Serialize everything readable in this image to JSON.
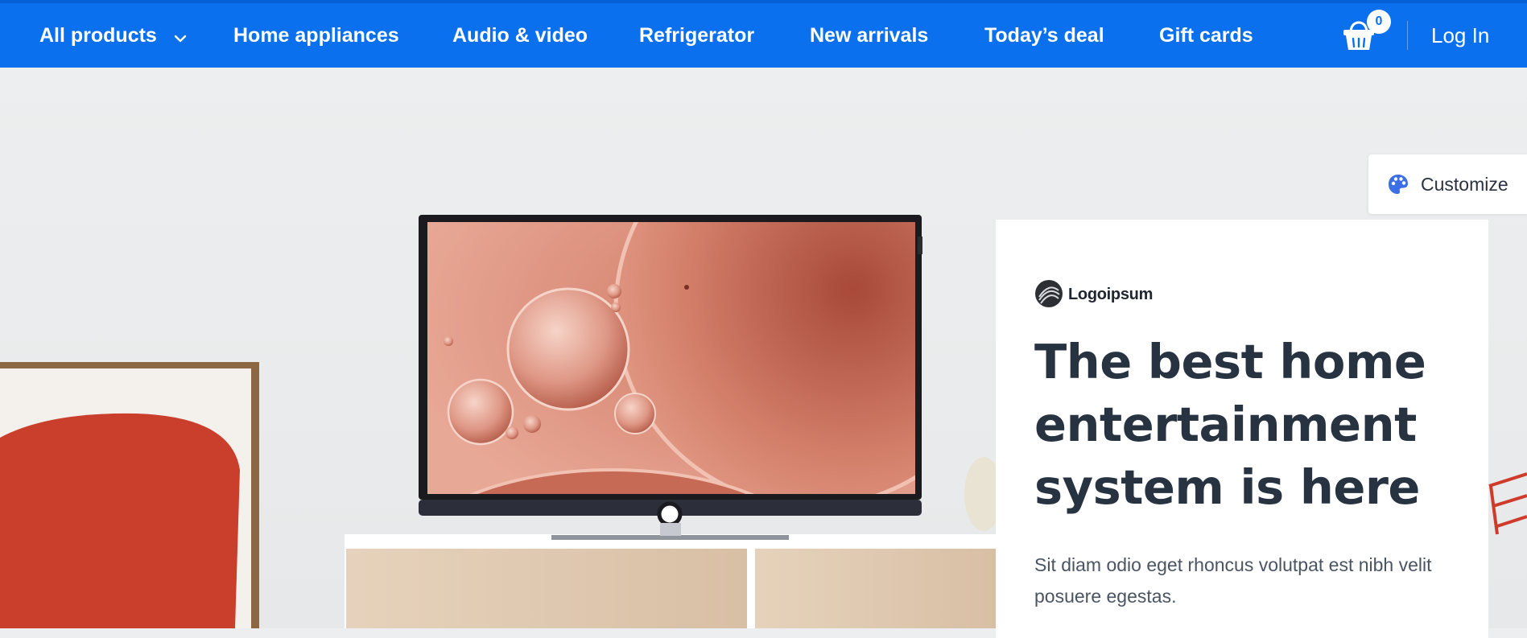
{
  "nav": {
    "all_products": "All products",
    "items": [
      "Home appliances",
      "Audio & video",
      "Refrigerator",
      "New arrivals",
      "Today’s deal",
      "Gift cards"
    ],
    "cart_count": "0",
    "login": "Log In",
    "background_color": "#0a70ee"
  },
  "customize": {
    "label": "Customize",
    "icon": "palette-icon"
  },
  "hero_card": {
    "brand": "Logoipsum",
    "headline": "The best home entertainment system is here",
    "description": "Sit diam odio eget rhoncus volutpat est nibh velit posuere egestas."
  }
}
